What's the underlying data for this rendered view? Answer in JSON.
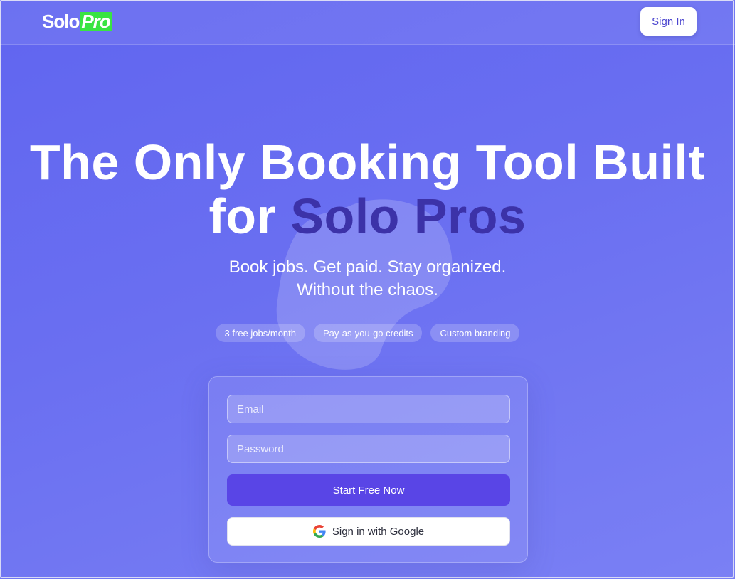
{
  "brand": {
    "logo_solo": "Solo",
    "logo_pro": "Pro",
    "accent_color": "#39e442"
  },
  "header": {
    "signin_label": "Sign In"
  },
  "hero": {
    "title_line1": "The Only Booking Tool Built",
    "title_for": "for ",
    "title_accent": "Solo Pros",
    "subtitle_line1": "Book jobs. Get paid. Stay organized.",
    "subtitle_line2": "Without the chaos."
  },
  "pills": [
    "3 free jobs/month",
    "Pay-as-you-go credits",
    "Custom branding"
  ],
  "form": {
    "email_placeholder": "Email",
    "email_value": "",
    "password_placeholder": "Password",
    "password_value": "",
    "primary_label": "Start Free Now",
    "google_label": "Sign in with Google",
    "google_icon": "google-g-icon"
  },
  "colors": {
    "background": "#6367f0",
    "primary_button": "#5945e6",
    "title_accent": "#3c32a8"
  }
}
